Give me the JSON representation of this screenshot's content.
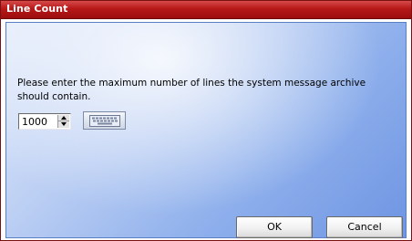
{
  "dialog": {
    "title": "Line Count",
    "message": "Please enter the maximum number of lines the system message archive should contain.",
    "max_lines_value": "1000",
    "ok_label": "OK",
    "cancel_label": "Cancel",
    "icons": {
      "spin_up": "chevron-up-icon",
      "spin_down": "chevron-down-icon",
      "keyboard": "keyboard-icon"
    },
    "colors": {
      "title_bar": "#b71818",
      "panel_gradient_start": "#e4ecfb",
      "panel_gradient_end": "#6f95e3"
    }
  }
}
